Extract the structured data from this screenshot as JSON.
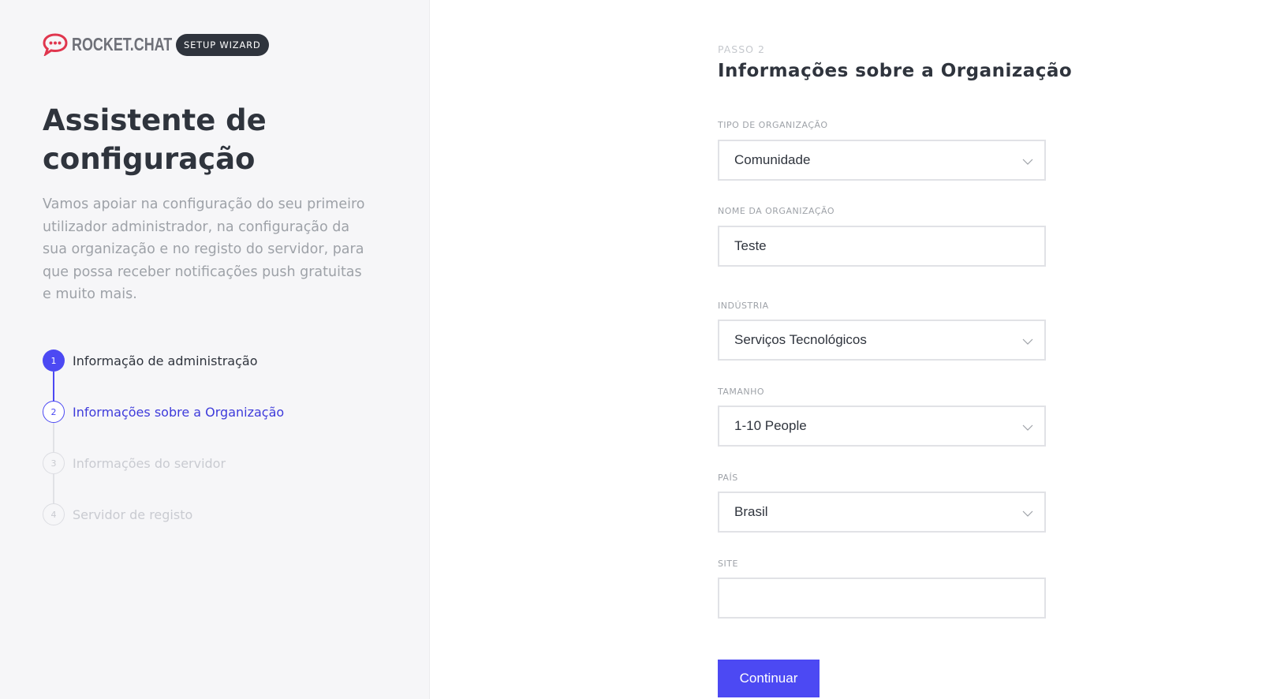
{
  "brand": {
    "logo_text": "ROCKET.CHAT",
    "badge": "SETUP WIZARD",
    "logo_color": "#e0364e"
  },
  "sidebar": {
    "title": "Assistente de configuração",
    "description": "Vamos apoiar na configuração do seu primeiro utilizador administrador, na configuração da sua organização e no registo do servidor, para que possa receber notificações push gratuitas e muito mais.",
    "steps": [
      {
        "number": "1",
        "label": "Informação de administração",
        "state": "done"
      },
      {
        "number": "2",
        "label": "Informações sobre a Organização",
        "state": "active"
      },
      {
        "number": "3",
        "label": "Informações do servidor",
        "state": "pending"
      },
      {
        "number": "4",
        "label": "Servidor de registo",
        "state": "pending"
      }
    ]
  },
  "form": {
    "kicker": "PASSO 2",
    "title": "Informações sobre a Organização",
    "fields": {
      "org_type": {
        "label": "TIPO DE ORGANIZAÇÃO",
        "value": "Comunidade"
      },
      "org_name": {
        "label": "NOME DA ORGANIZAÇÃO",
        "value": "Teste"
      },
      "industry": {
        "label": "INDÚSTRIA",
        "value": "Serviços Tecnológicos"
      },
      "size": {
        "label": "TAMANHO",
        "value": "1-10 People"
      },
      "country": {
        "label": "PAÍS",
        "value": "Brasil"
      },
      "site": {
        "label": "SITE",
        "value": ""
      }
    },
    "continue_label": "Continuar"
  },
  "colors": {
    "accent": "#4c49f3",
    "text_dark": "#2f343d",
    "text_muted": "#9ea2a8",
    "border": "#e1e2e6"
  }
}
